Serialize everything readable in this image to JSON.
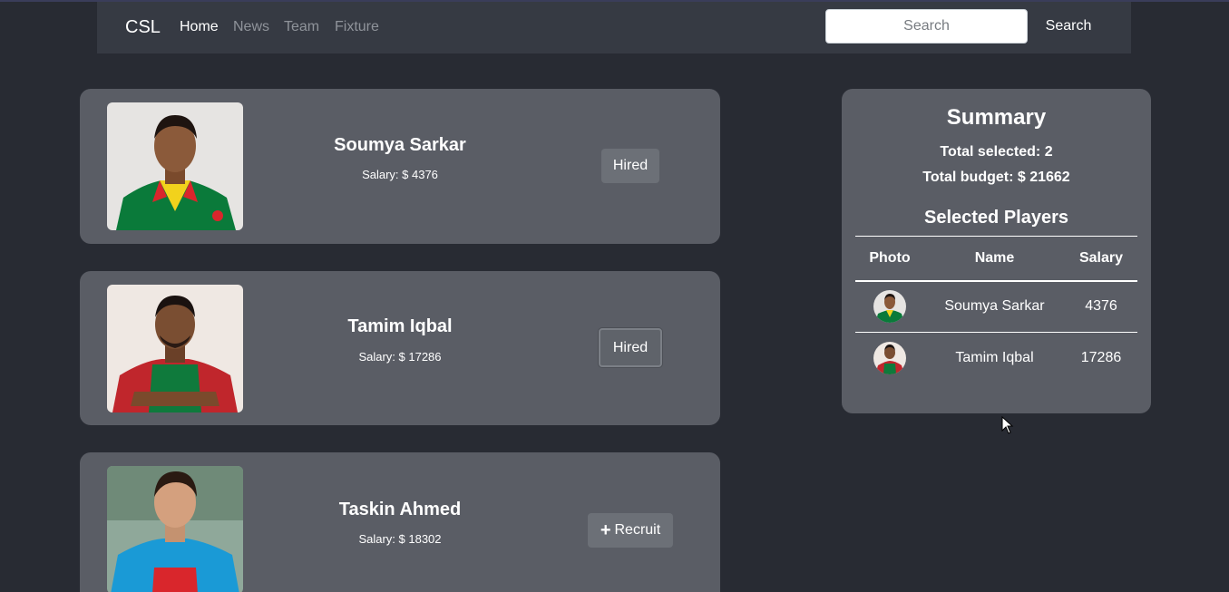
{
  "navbar": {
    "brand": "CSL",
    "links": [
      "Home",
      "News",
      "Team",
      "Fixture"
    ],
    "search_placeholder": "Search",
    "search_button": "Search"
  },
  "players": [
    {
      "name": "Soumya Sarkar",
      "salary": "Salary: $ 4376",
      "button": "Hired"
    },
    {
      "name": "Tamim Iqbal",
      "salary": "Salary: $ 17286",
      "button": "Hired"
    },
    {
      "name": "Taskin Ahmed",
      "salary": "Salary: $ 18302",
      "button": "Recruit"
    }
  ],
  "summary": {
    "title": "Summary",
    "total_selected": "Total selected: 2",
    "total_budget": "Total budget: $ 21662",
    "selected_heading": "Selected Players",
    "columns": [
      "Photo",
      "Name",
      "Salary"
    ],
    "rows": [
      {
        "name": "Soumya Sarkar",
        "salary": "4376"
      },
      {
        "name": "Tamim Iqbal",
        "salary": "17286"
      }
    ]
  },
  "colors": {
    "background": "#282b33",
    "navbar": "#363a43",
    "card": "#5a5d65",
    "button": "#6c7077"
  }
}
